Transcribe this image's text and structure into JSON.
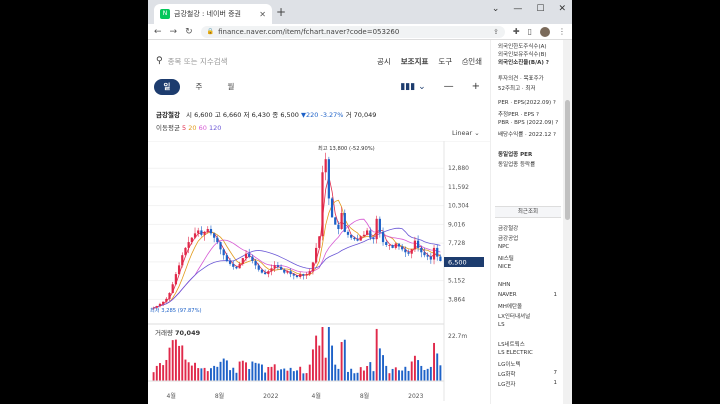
{
  "browser": {
    "tab_title": "금강철강 : 네이버 증권",
    "favicon": "N",
    "url": "finance.naver.com/item/fchart.naver?code=053260"
  },
  "toolbar": {
    "search_placeholder": "종목 또는 지수검색",
    "menu": [
      "공시",
      "보조지표",
      "도구",
      "인쇄"
    ],
    "periods": [
      "일",
      "주",
      "월"
    ],
    "active_period": "일"
  },
  "quote": {
    "name": "금강철강",
    "open_label": "시",
    "open": "6,600",
    "high_label": "고",
    "high": "6,660",
    "low_label": "저",
    "low": "6,430",
    "close_label": "종",
    "close": "6,500",
    "change": "▼220",
    "change_pct": "-3.27%",
    "volume_label": "거",
    "volume": "70,049"
  },
  "moving_avg": {
    "label": "이동평균",
    "periods": [
      "5",
      "20",
      "60",
      "120"
    ]
  },
  "scale_mode": "Linear",
  "volume_panel": {
    "label": "거래량",
    "value": "70,049",
    "axis_label": "22.7m"
  },
  "sidebar": {
    "rows": [
      {
        "t": "외국인한도주식수(A)"
      },
      {
        "t": "외국인보유주식수(B)"
      },
      {
        "t": "외국인소진율(B/A) ?"
      },
      {
        "t": "투자의견 · 목표주가"
      },
      {
        "t": "52주최고 · 최저"
      },
      {
        "t": "PER · EPS(2022.09) ?"
      },
      {
        "t": "추정PER · EPS ?"
      },
      {
        "t": "PBR · BPS (2022.09) ?"
      },
      {
        "t": "배당수익률 · 2022.12 ?"
      },
      {
        "t": "동일업종 PER"
      },
      {
        "t": "동일업종 등락률"
      }
    ],
    "recent_header": "최근조회",
    "recent": [
      "금강철강",
      "금강공업",
      "NPC",
      "NI스틸",
      "NICE",
      "NHN",
      "NAVER",
      "MH에탄올",
      "LX인터내셔널",
      "LS",
      "LS네트웍스",
      "LS ELECTRIC",
      "LG이노텍",
      "LG화학",
      "LG전자"
    ],
    "recent_nums": [
      "",
      "",
      "",
      "",
      "",
      "",
      "1",
      "",
      "",
      "",
      "",
      "",
      "",
      "7",
      "1"
    ]
  },
  "chart_data": {
    "type": "candlestick",
    "title": "",
    "y_axis_ticks": [
      12880,
      11592,
      10304,
      9016,
      7728,
      6440,
      5152,
      3864
    ],
    "ylim": [
      3200,
      14200
    ],
    "x_tick_labels": [
      "4월",
      "8월",
      "2022",
      "4월",
      "8월",
      "2023"
    ],
    "last_price_label": "6,500",
    "high_annotation": "최고 13,800 (-52.90%)",
    "low_annotation": "최저 3,285 (97.87%)",
    "close_series": [
      3285,
      3400,
      3550,
      3700,
      3900,
      4300,
      4900,
      5600,
      6200,
      6900,
      7400,
      7800,
      8100,
      8400,
      8600,
      8300,
      8500,
      8700,
      8400,
      8100,
      7800,
      7300,
      6900,
      6500,
      6300,
      6100,
      6000,
      6300,
      6700,
      7000,
      6800,
      6500,
      6200,
      5900,
      5700,
      5600,
      5800,
      6000,
      6200,
      6100,
      5900,
      5700,
      5800,
      5600,
      5500,
      5400,
      5600,
      5500,
      5600,
      5800,
      6400,
      7400,
      8200,
      12600,
      13500,
      10800,
      9500,
      9000,
      8700,
      9800,
      8500,
      8300,
      8100,
      8000,
      7900,
      8200,
      8300,
      8600,
      8100,
      8000,
      9400,
      8500,
      7800,
      7600,
      7600,
      7400,
      7700,
      7500,
      7300,
      7100,
      7000,
      7300,
      7900,
      7400,
      7100,
      6900,
      6800,
      6600,
      7400,
      6800,
      6500
    ]
  }
}
